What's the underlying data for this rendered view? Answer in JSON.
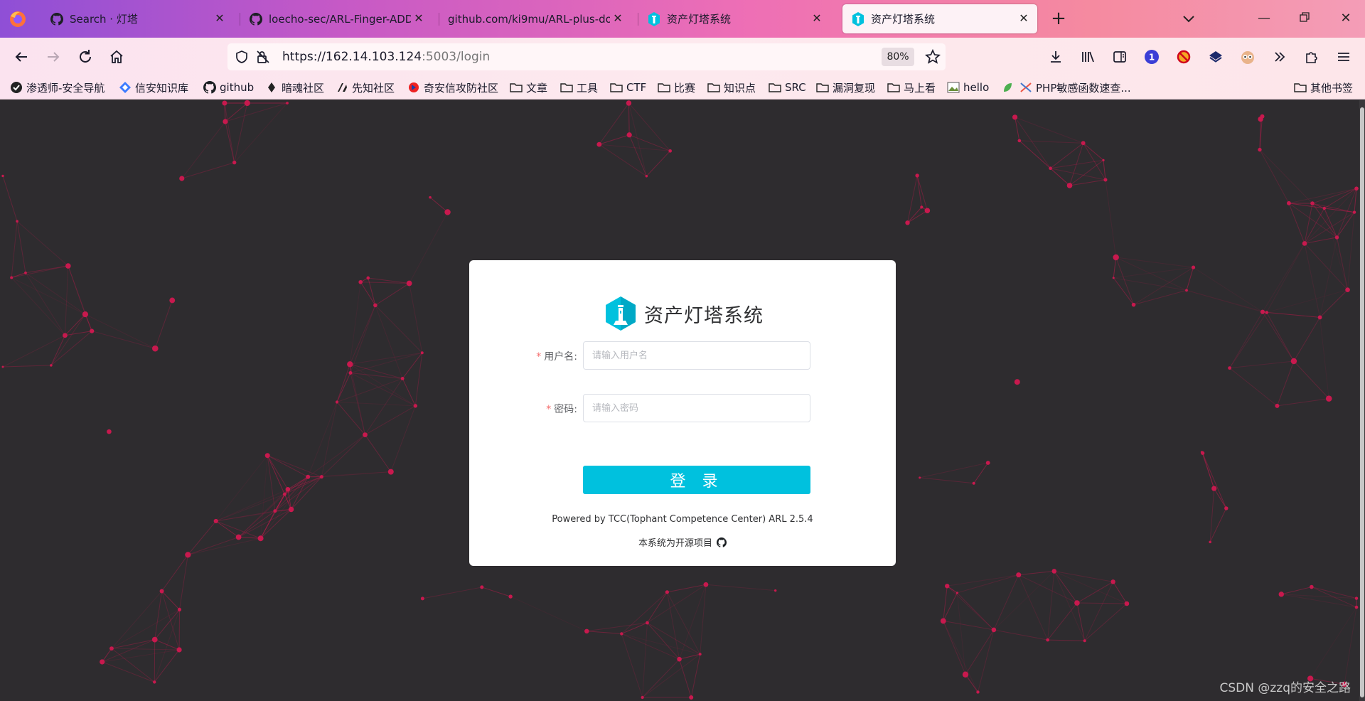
{
  "browser": {
    "tabs": [
      {
        "title": "Search · 灯塔",
        "icon": "github-icon",
        "active": false
      },
      {
        "title": "loecho-sec/ARL-Finger-ADD: ARL",
        "icon": "github-icon",
        "active": false
      },
      {
        "title": "github.com/ki9mu/ARL-plus-docker",
        "icon": "none",
        "active": false
      },
      {
        "title": "资产灯塔系统",
        "icon": "arl-lighthouse-icon",
        "active": false
      },
      {
        "title": "资产灯塔系统",
        "icon": "arl-lighthouse-icon",
        "active": true
      }
    ],
    "url": {
      "host": "https://162.14.103.124",
      "rest": ":5003/login"
    },
    "zoom": "80%",
    "bookmarks": [
      {
        "label": "渗透师-安全导航",
        "icon": "site-icon"
      },
      {
        "label": "信安知识库",
        "icon": "site-icon"
      },
      {
        "label": "github",
        "icon": "github-icon"
      },
      {
        "label": "暗魂社区",
        "icon": "site-icon"
      },
      {
        "label": "先知社区",
        "icon": "site-icon"
      },
      {
        "label": "奇安信攻防社区",
        "icon": "site-icon"
      },
      {
        "label": "文章",
        "icon": "folder-icon"
      },
      {
        "label": "工具",
        "icon": "folder-icon"
      },
      {
        "label": "CTF",
        "icon": "folder-icon"
      },
      {
        "label": "比赛",
        "icon": "folder-icon"
      },
      {
        "label": "知识点",
        "icon": "folder-icon"
      },
      {
        "label": "SRC",
        "icon": "folder-icon"
      },
      {
        "label": "漏洞复现",
        "icon": "folder-icon"
      },
      {
        "label": "马上看",
        "icon": "folder-icon"
      },
      {
        "label": "hello",
        "icon": "image-icon"
      },
      {
        "label": "",
        "icon": "leaf-icon"
      },
      {
        "label": "PHP敏感函数速查...",
        "icon": "site-icon"
      },
      {
        "label": "其他书签",
        "icon": "folder-icon"
      }
    ],
    "colors": {
      "accent": "#00c1de",
      "network_dot": "#c8194e",
      "background": "#2e2c2f"
    }
  },
  "login": {
    "brand_title": "资产灯塔系统",
    "username": {
      "label": "用户名:",
      "placeholder": "请输入用户名",
      "value": ""
    },
    "password": {
      "label": "密码:",
      "placeholder": "请输入密码",
      "value": ""
    },
    "submit_label": "登 录",
    "powered_by": "Powered by TCC(Tophant Competence Center) ARL 2.5.4",
    "open_source": "本系统为开源项目"
  },
  "watermark": "CSDN @zzq的安全之路"
}
